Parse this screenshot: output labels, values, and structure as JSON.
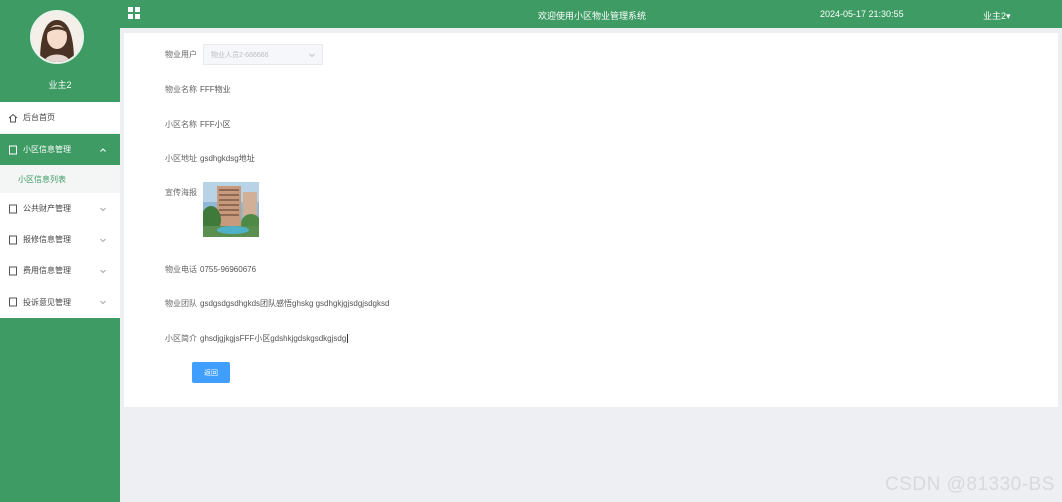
{
  "sidebar": {
    "username": "业主2",
    "menu": {
      "home": "后台首页",
      "community_mgmt": "小区信息管理",
      "community_list": "小区信息列表",
      "public_assets": "公共财产管理",
      "repair": "报修信息管理",
      "fees": "费用信息管理",
      "complaints": "投诉意见管理"
    }
  },
  "topbar": {
    "welcome": "欢迎使用小区物业管理系统",
    "datetime": "2024-05-17 21:30:55",
    "user": "业主2"
  },
  "form": {
    "property_user_label": "物业用户",
    "property_user_value": "物业人员2-666666",
    "property_name_label": "物业名称",
    "property_name_value": "FFF物业",
    "community_name_label": "小区名称",
    "community_name_value": "FFF小区",
    "community_address_label": "小区地址",
    "community_address_value": "gsdhgkdsg地址",
    "promo_image_label": "宣传海报",
    "phone_label": "物业电话",
    "phone_value": "0755-96960676",
    "team_label": "物业团队",
    "team_value": "gsdgsdgsdhgkds团队感悟ghskg gsdhgkjgjsdgjsdgksd",
    "intro_label": "小区简介",
    "intro_value": "ghsdjgjkgjsFFF小区gdshkjgdskgsdkgjsdg",
    "back_button": "返回"
  },
  "watermark": "CSDN @81330-BS",
  "colors": {
    "primary": "#3d9b63",
    "button": "#409eff"
  }
}
